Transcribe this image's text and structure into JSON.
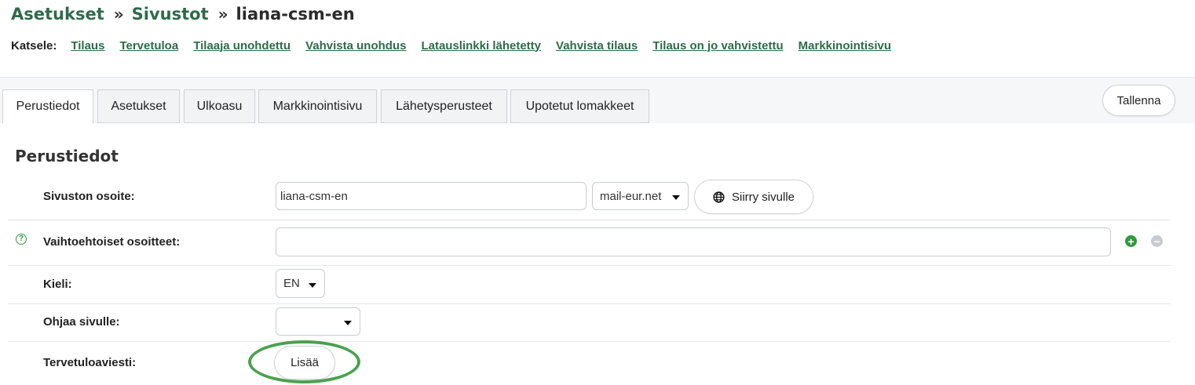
{
  "breadcrumb": {
    "items": [
      "Asetukset",
      "Sivustot"
    ],
    "separator": "»",
    "current": "liana-csm-en"
  },
  "view": {
    "label": "Katsele:",
    "links": [
      "Tilaus",
      "Tervetuloa",
      "Tilaaja unohdettu",
      "Vahvista unohdus",
      "Latauslinkki lähetetty",
      "Vahvista tilaus",
      "Tilaus on jo vahvistettu",
      "Markkinointisivu"
    ]
  },
  "tabs": [
    "Perustiedot",
    "Asetukset",
    "Ulkoasu",
    "Markkinointisivu",
    "Lähetysperusteet",
    "Upotetut lomakkeet"
  ],
  "active_tab": "Perustiedot",
  "save_label": "Tallenna",
  "section_title": "Perustiedot",
  "fields": {
    "site_address": {
      "label": "Sivuston osoite:",
      "value": "liana-csm-en",
      "domain": "mail-eur.net",
      "go_button": "Siirry sivulle"
    },
    "alt_addresses": {
      "label": "Vaihtoehtoiset osoitteet:",
      "value": "",
      "help": "?",
      "add": "+",
      "remove": "−"
    },
    "language": {
      "label": "Kieli:",
      "value": "EN"
    },
    "redirect": {
      "label": "Ohjaa sivulle:",
      "value": ""
    },
    "welcome": {
      "label": "Tervetuloaviesti:",
      "button": "Lisää"
    }
  },
  "icons": {
    "globe": "globe-icon",
    "help": "help-icon",
    "add": "plus-circle-icon",
    "remove": "minus-circle-icon",
    "dropdown": "caret-down-icon"
  },
  "colors": {
    "accent_green": "#2e6b4a",
    "add_green": "#2f9a3f",
    "remove_gray": "#c8cbcf",
    "highlight": "#4aa14e"
  }
}
